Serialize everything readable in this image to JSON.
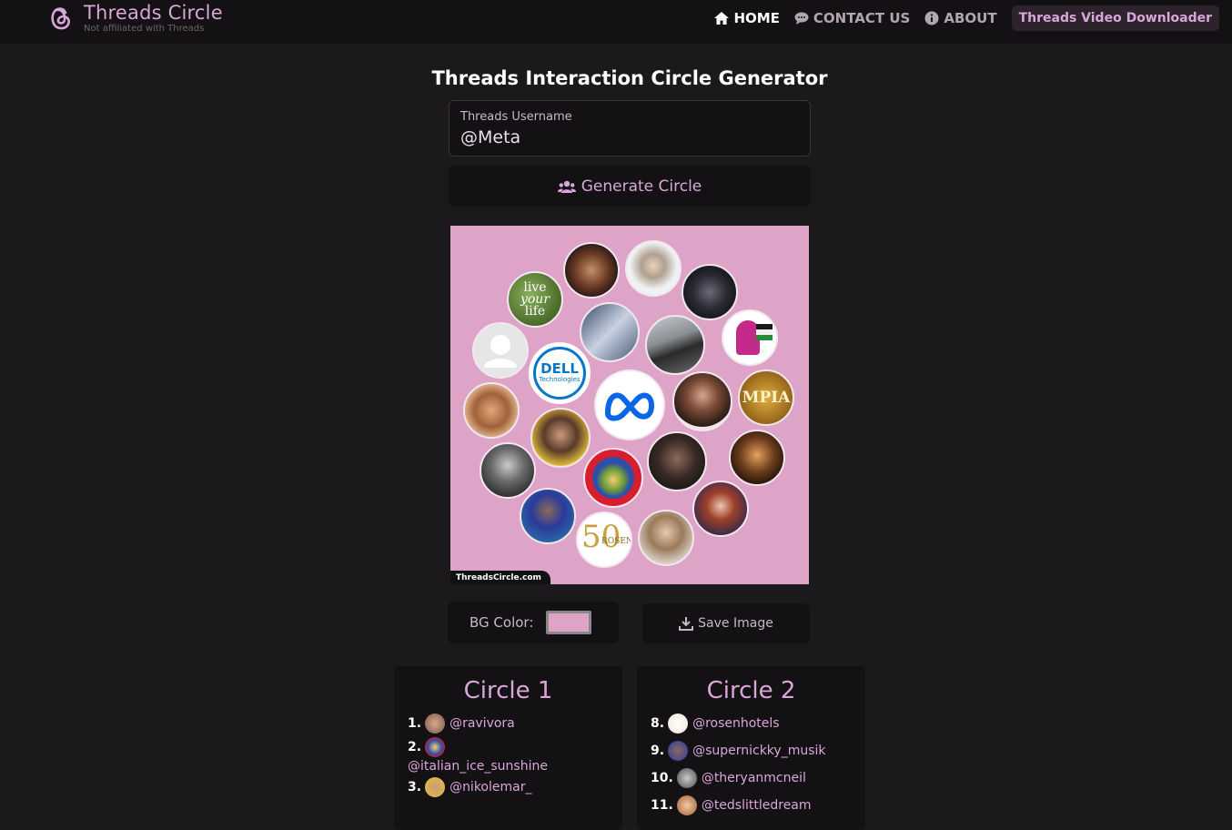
{
  "brand": {
    "name": "Threads Circle",
    "subtitle": "Not affiliated with Threads"
  },
  "nav": [
    {
      "label": "HOME",
      "icon": "home-icon",
      "active": true
    },
    {
      "label": "CONTACT US",
      "icon": "chat-icon",
      "active": false
    },
    {
      "label": "ABOUT",
      "icon": "info-icon",
      "active": false
    }
  ],
  "nav_pill": "Threads Video Downloader",
  "title": "Threads Interaction Circle Generator",
  "form": {
    "label": "Threads Username",
    "value": "@Meta",
    "generate_label": "Generate Circle"
  },
  "circle": {
    "bg_color": "#dda4c8",
    "watermark": "ThreadsCircle.com",
    "center_logo": "meta-logo",
    "badges": {
      "dell_line1": "DELL",
      "dell_line2": "Technologies",
      "mpia": "MPIA",
      "rosen": "ROSEN",
      "live1": "live",
      "live2": "your",
      "live3": "life",
      "fifty": "50"
    }
  },
  "controls": {
    "bg_label": "BG Color:",
    "save_label": "Save Image"
  },
  "lists": {
    "c1": {
      "title": "Circle 1",
      "items": [
        {
          "num": "1.",
          "user": "@ravivora",
          "color": "#7a5a48"
        },
        {
          "num": "2.",
          "user": "@italian_ice_sunshine",
          "color": "#c8203a"
        },
        {
          "num": "3.",
          "user": "@nikolemar_",
          "color": "#b88c5a"
        }
      ]
    },
    "c2": {
      "title": "Circle 2",
      "items": [
        {
          "num": "8.",
          "user": "@rosenhotels",
          "color": "#efe6d6"
        },
        {
          "num": "9.",
          "user": "@supernickky_musik",
          "color": "#2c3aa8"
        },
        {
          "num": "10.",
          "user": "@theryanmcneil",
          "color": "#8a8a8a"
        },
        {
          "num": "11.",
          "user": "@tedslittledream",
          "color": "#d89a6a"
        }
      ]
    }
  }
}
